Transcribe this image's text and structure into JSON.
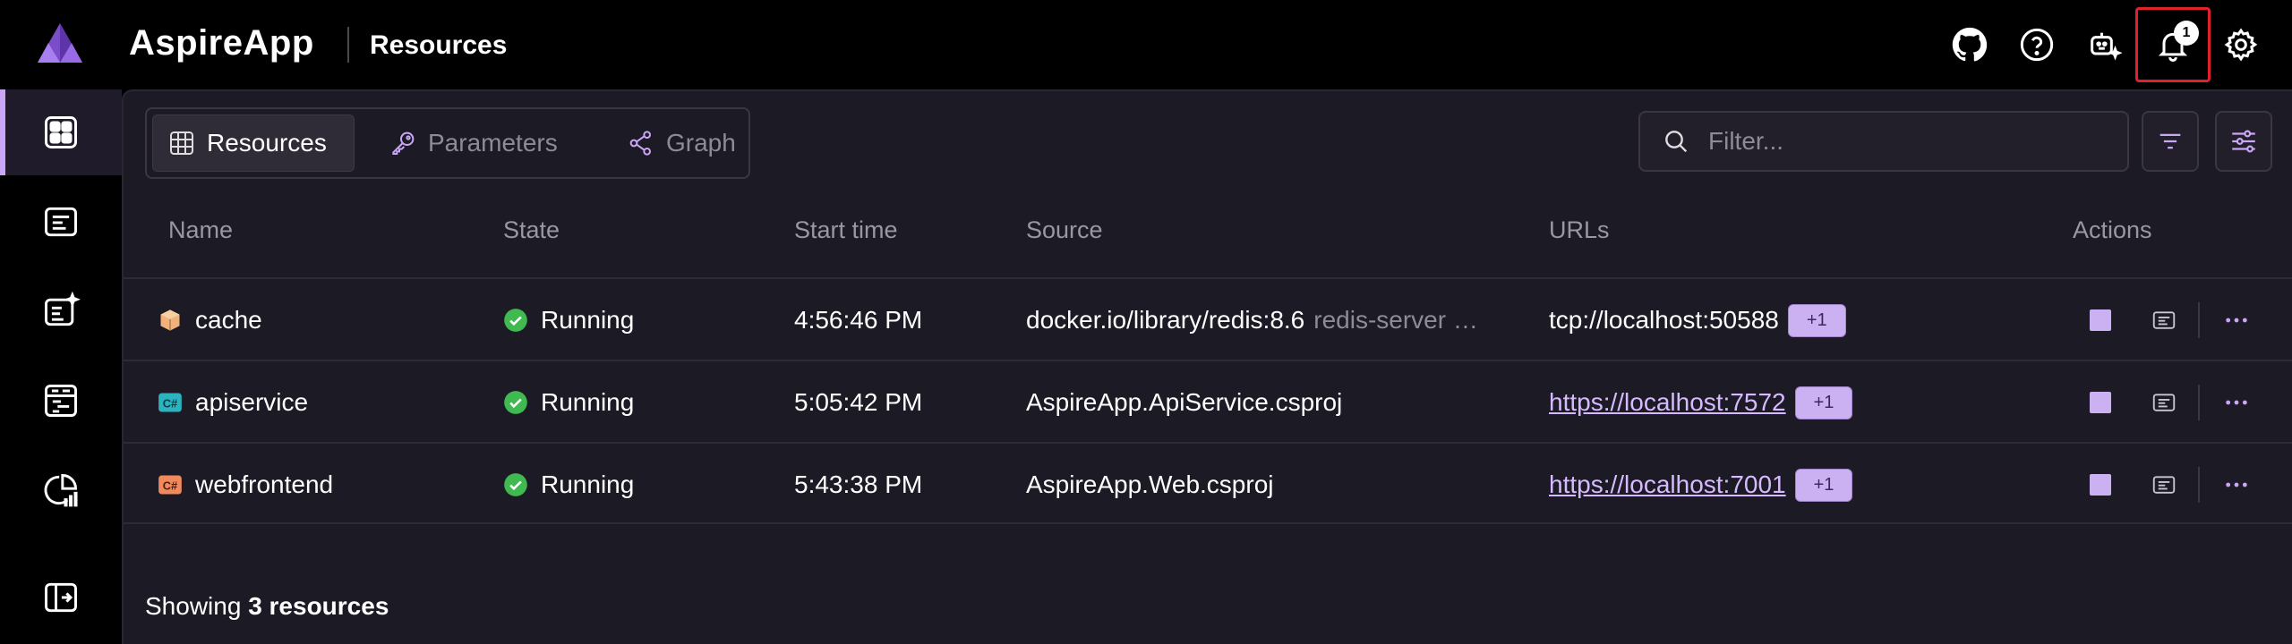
{
  "header": {
    "app_name": "AspireApp",
    "page_title": "Resources",
    "notification_count": "1",
    "buttons": [
      "github-icon",
      "help-icon",
      "ai-assistant-icon",
      "bell-icon",
      "gear-icon"
    ]
  },
  "sidebar": {
    "items": [
      {
        "name": "resources",
        "icon": "grid-icon",
        "active": true
      },
      {
        "name": "console-logs",
        "icon": "console-icon"
      },
      {
        "name": "structured-logs",
        "icon": "structured-logs-icon"
      },
      {
        "name": "traces",
        "icon": "traces-icon"
      },
      {
        "name": "metrics",
        "icon": "metrics-icon"
      },
      {
        "name": "collapse",
        "icon": "collapse-icon"
      }
    ]
  },
  "tabs": {
    "resources": "Resources",
    "parameters": "Parameters",
    "graph": "Graph"
  },
  "filter": {
    "placeholder": "Filter..."
  },
  "table": {
    "columns": {
      "name": "Name",
      "state": "State",
      "start_time": "Start time",
      "source": "Source",
      "urls": "URLs",
      "actions": "Actions"
    },
    "rows": [
      {
        "name": "cache",
        "icon": "container-icon",
        "state": "Running",
        "start_time": "4:56:46 PM",
        "source": "docker.io/library/redis:8.6",
        "source_extra": "redis-server …",
        "url": "tcp://localhost:50588",
        "url_is_link": false,
        "more_urls": "+1"
      },
      {
        "name": "apiservice",
        "icon": "csharp-project-icon",
        "state": "Running",
        "start_time": "5:05:42 PM",
        "source": "AspireApp.ApiService.csproj",
        "source_extra": "",
        "url": "https://localhost:7572",
        "url_is_link": true,
        "more_urls": "+1"
      },
      {
        "name": "webfrontend",
        "icon": "csharp-project-icon",
        "state": "Running",
        "start_time": "5:43:38 PM",
        "source": "AspireApp.Web.csproj",
        "source_extra": "",
        "url": "https://localhost:7001",
        "url_is_link": true,
        "more_urls": "+1"
      }
    ]
  },
  "footer": {
    "prefix": "Showing",
    "count_text": "3 resources"
  },
  "colors": {
    "accent": "#cbb1f2",
    "running": "#3fb950",
    "notification_highlight": "#e0202a"
  }
}
